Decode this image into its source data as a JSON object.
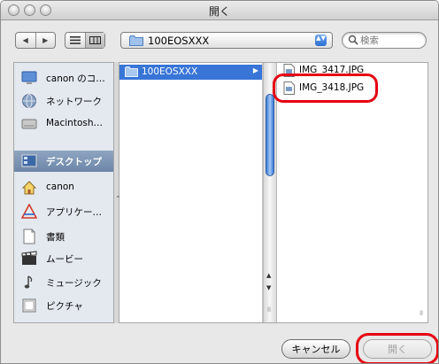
{
  "window": {
    "title": "開く"
  },
  "toolbar": {
    "back_glyph": "◀",
    "forward_glyph": "▶",
    "path_label": "100EOSXXX",
    "path_popup_arrows": "▲▼",
    "search_placeholder": "検索"
  },
  "sidebar": {
    "items": [
      {
        "label": "canon のコ…",
        "icon": "computer-icon"
      },
      {
        "label": "ネットワーク",
        "icon": "network-globe-icon"
      },
      {
        "label": "Macintosh…",
        "icon": "hard-disk-icon"
      },
      {
        "label": "デスクトップ",
        "icon": "desktop-icon",
        "selected": true
      },
      {
        "label": "canon",
        "icon": "home-icon"
      },
      {
        "label": "アプリケー…",
        "icon": "applications-icon"
      },
      {
        "label": "書類",
        "icon": "documents-icon"
      },
      {
        "label": "ムービー",
        "icon": "movies-clapboard-icon"
      },
      {
        "label": "ミュージック",
        "icon": "music-note-icon"
      },
      {
        "label": "ピクチャ",
        "icon": "pictures-frame-icon"
      }
    ]
  },
  "browser": {
    "column1": {
      "folder": "100EOSXXX",
      "expand_glyph": "▶"
    },
    "files": [
      {
        "name": "IMG_3417.JPG"
      },
      {
        "name": "IMG_3418.JPG"
      }
    ],
    "scroll_up_glyph": "▲",
    "scroll_down_glyph": "▼",
    "grip_glyph": "ll"
  },
  "buttons": {
    "cancel": "キャンセル",
    "open": "開く"
  },
  "colors": {
    "selection": "#3875d7",
    "highlight_ring": "#e60012",
    "sidebar_bg": "#e4e9f0"
  }
}
